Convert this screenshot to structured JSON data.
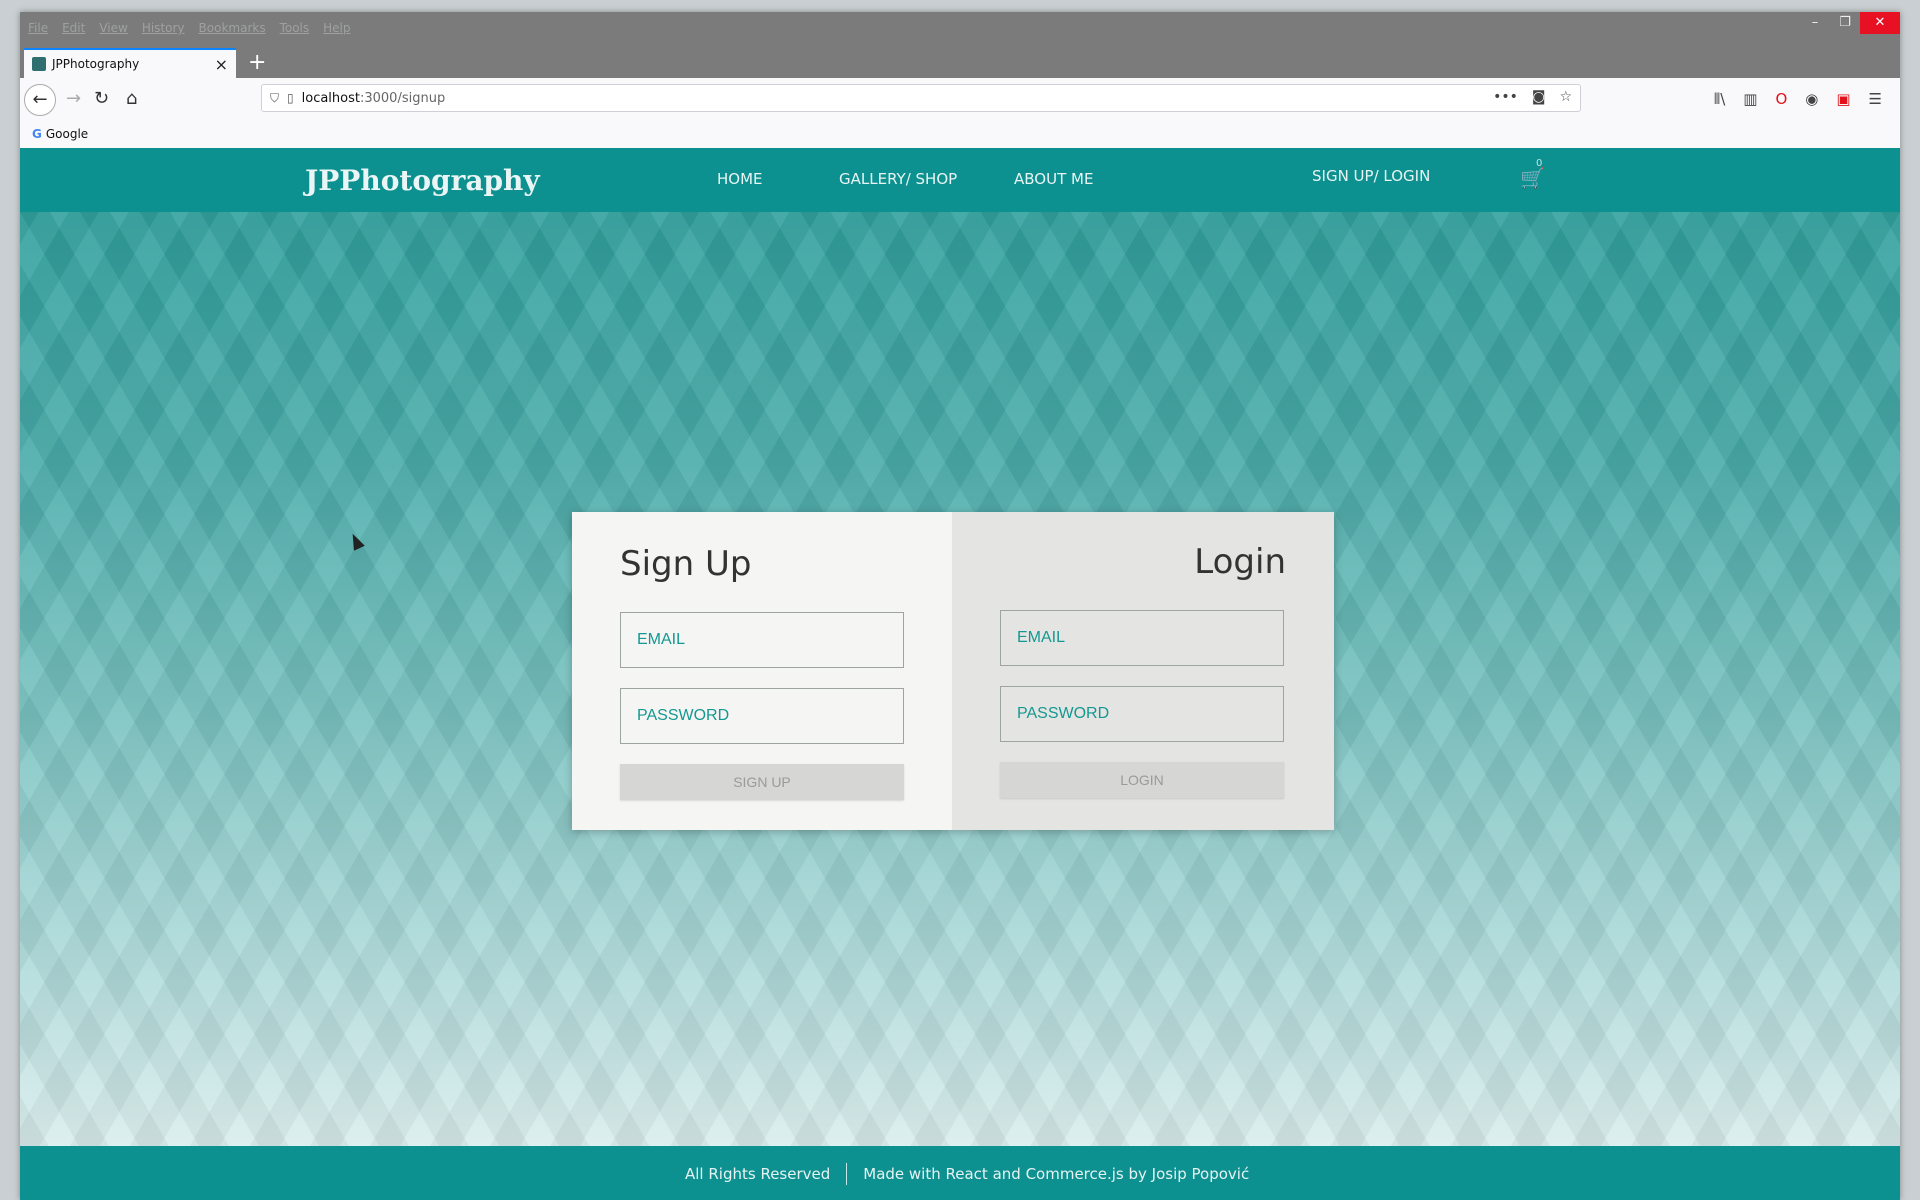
{
  "browser": {
    "menu": [
      "File",
      "Edit",
      "View",
      "History",
      "Bookmarks",
      "Tools",
      "Help"
    ],
    "window_controls": {
      "minimize": "–",
      "restore": "❐",
      "close": "✕"
    },
    "tab": {
      "title": "JPPhotography",
      "close": "×"
    },
    "new_tab": "+",
    "nav": {
      "back": "←",
      "forward": "→",
      "reload": "↻",
      "home": "⌂"
    },
    "url": {
      "host": "localhost",
      "path": ":3000/signup",
      "shield": "⛉",
      "page": "▯"
    },
    "url_actions": {
      "more": "•••",
      "pocket": "◙",
      "bookmark": "☆"
    },
    "toolbar": {
      "library": "⫴\\",
      "sidebar": "▥",
      "opera": "O",
      "account": "◉",
      "extension": "▣",
      "menu": "☰"
    },
    "bookmarks": [
      {
        "label": "Google",
        "icon": "G"
      }
    ]
  },
  "site": {
    "logo": "JPPhotography",
    "nav": {
      "home": "HOME",
      "gallery": "GALLERY/ SHOP",
      "about": "ABOUT ME",
      "signup_login": "SIGN UP/ LOGIN"
    },
    "cart": {
      "icon": "🛒",
      "count": "0"
    },
    "signup": {
      "title": "Sign Up",
      "email_placeholder": "EMAIL",
      "password_placeholder": "PASSWORD",
      "button": "SIGN UP"
    },
    "login": {
      "title": "Login",
      "email_placeholder": "EMAIL",
      "password_placeholder": "PASSWORD",
      "button": "LOGIN"
    },
    "footer": {
      "left": "All Rights Reserved",
      "right": "Made with React and Commerce.js by Josip Popović"
    }
  }
}
